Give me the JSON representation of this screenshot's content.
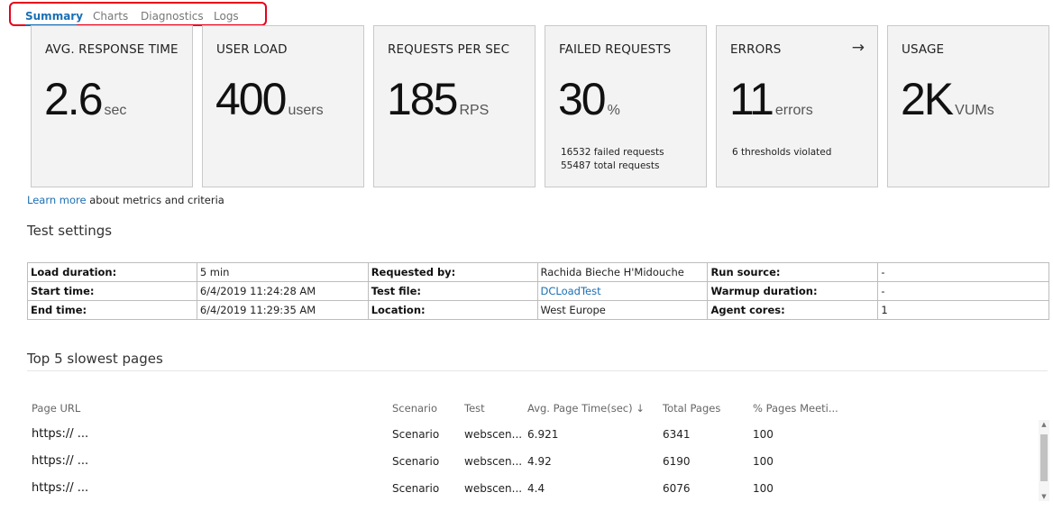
{
  "tabs": [
    {
      "label": "Summary"
    },
    {
      "label": "Charts"
    },
    {
      "label": "Diagnostics"
    },
    {
      "label": "Logs"
    }
  ],
  "cards": [
    {
      "title": "AVG. RESPONSE TIME",
      "value": "2.6",
      "unit": "sec"
    },
    {
      "title": "USER LOAD",
      "value": "400",
      "unit": "users"
    },
    {
      "title": "REQUESTS PER SEC",
      "value": "185",
      "unit": "RPS"
    },
    {
      "title": "FAILED REQUESTS",
      "value": "30",
      "unit": "%",
      "sub1": "16532 failed requests",
      "sub2": "55487 total requests"
    },
    {
      "title": "ERRORS",
      "value": "11",
      "unit": "errors",
      "sub1": "6 thresholds violated"
    },
    {
      "title": "USAGE",
      "value": "2K",
      "unit": "VUMs"
    }
  ],
  "learn": {
    "link": "Learn more",
    "text": " about metrics and criteria"
  },
  "settings": {
    "title": "Test settings",
    "rows": [
      [
        "Load duration:",
        "5 min",
        "Requested by:",
        "Rachida Bieche H'Midouche",
        "Run source:",
        "-"
      ],
      [
        "Start time:",
        "6/4/2019 11:24:28 AM",
        "Test file:",
        "DCLoadTest",
        "Warmup duration:",
        "-"
      ],
      [
        "End time:",
        "6/4/2019 11:29:35 AM",
        "Location:",
        "West Europe",
        "Agent cores:",
        "1"
      ]
    ]
  },
  "pages": {
    "title": "Top 5 slowest pages",
    "headers": [
      "Page URL",
      "Scenario",
      "Test",
      "Avg. Page Time(sec) ↓",
      "Total Pages",
      "% Pages Meeti..."
    ],
    "rows": [
      [
        "https:// ...",
        "Scenario",
        "webscen...",
        "6.921",
        "6341",
        "100"
      ],
      [
        "https:// ...",
        "Scenario",
        "webscen...",
        "4.92",
        "6190",
        "100"
      ],
      [
        "https:// ...",
        "Scenario",
        "webscen...",
        "4.4",
        "6076",
        "100"
      ]
    ]
  },
  "icons": {
    "errors_arrow": "arrow-right-icon",
    "scroll_up": "triangle-up-icon",
    "scroll_down": "triangle-down-icon"
  },
  "colors": {
    "accent": "#1a6fb4",
    "highlight": "#e8001c",
    "card_bg": "#f3f3f3"
  }
}
